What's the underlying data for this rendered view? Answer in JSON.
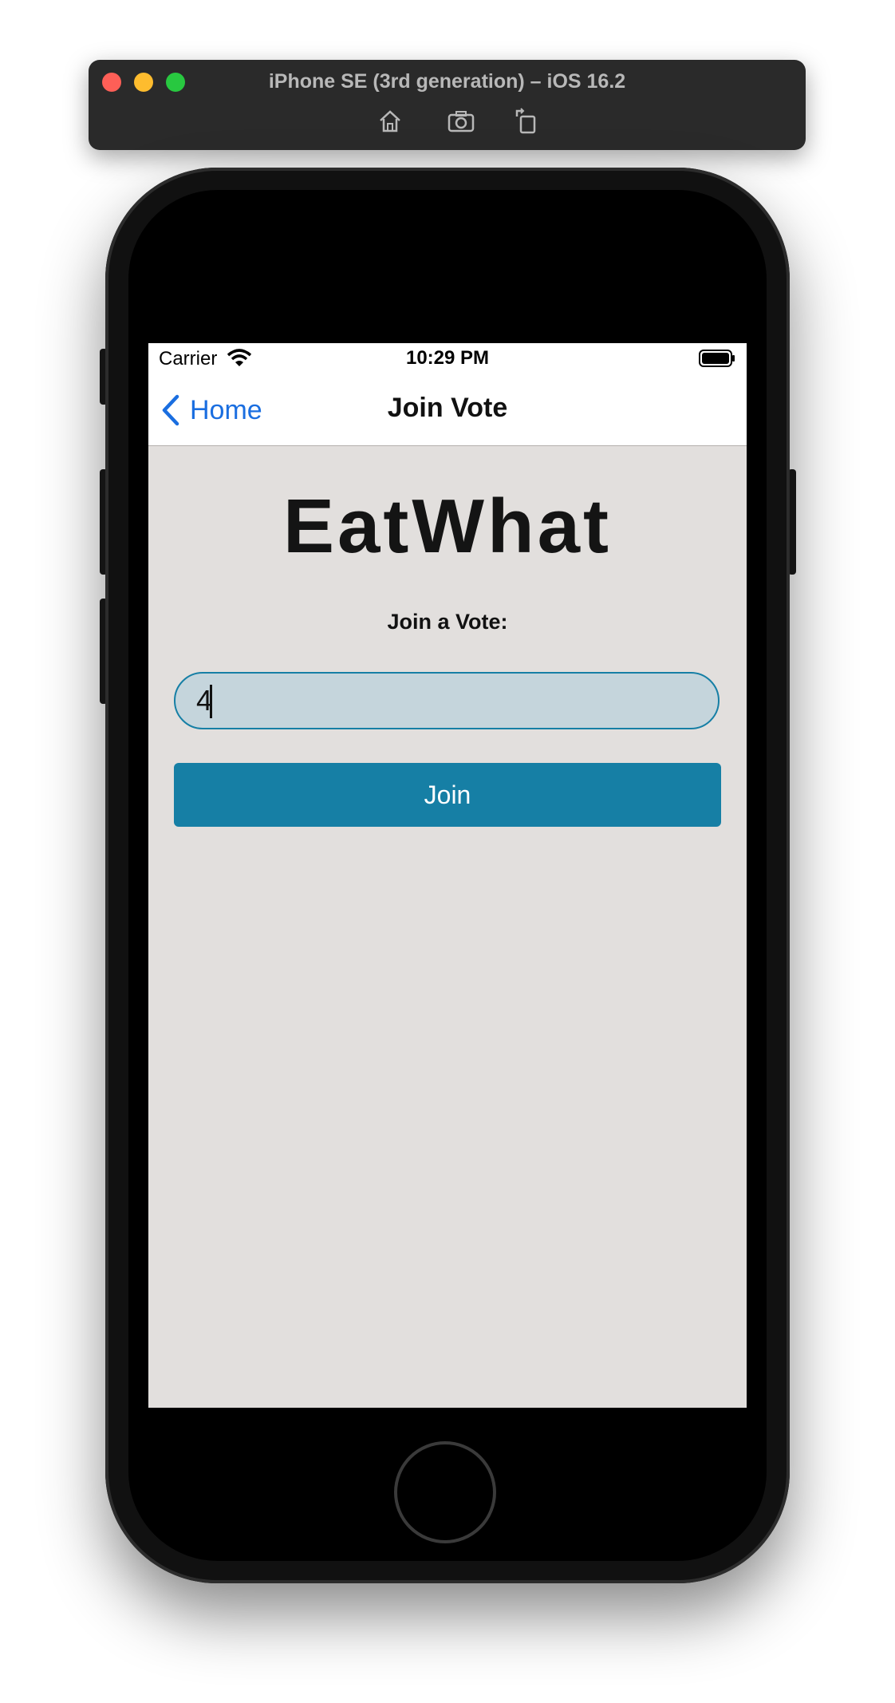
{
  "simulator": {
    "title": "iPhone SE (3rd generation) – iOS 16.2",
    "toolbar": [
      "home-icon",
      "screenshot-icon",
      "rotate-icon"
    ]
  },
  "status_bar": {
    "carrier": "Carrier",
    "time": "10:29 PM"
  },
  "nav": {
    "back_label": "Home",
    "title": "Join Vote"
  },
  "main": {
    "app_title": "EatWhat",
    "join_label": "Join a Vote:",
    "code_value": "4",
    "join_button_label": "Join"
  },
  "colors": {
    "accent": "#167fa5",
    "link": "#1a6ee0",
    "background": "#e2dfdd",
    "input_fill": "#c5d5dc"
  }
}
